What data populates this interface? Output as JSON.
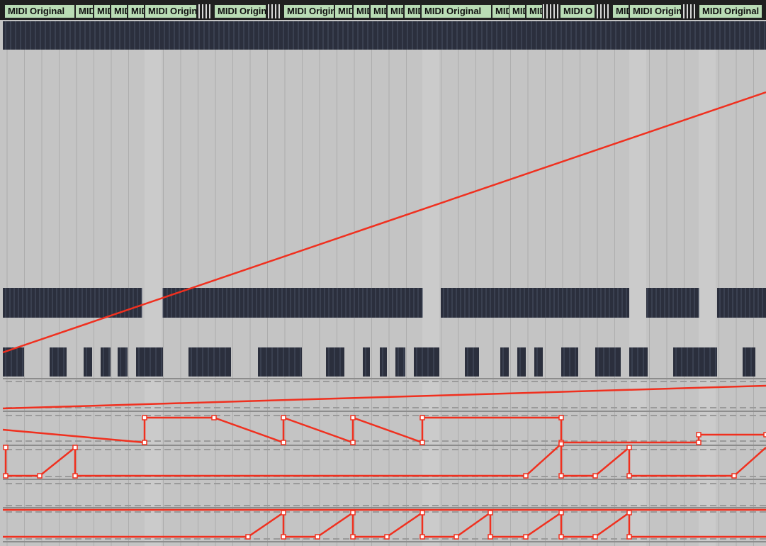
{
  "clip_label": "MIDI Original",
  "clip_label_short": "MIDI",
  "clip_label_mid": "MIDI Origin",
  "clip_label_cut": "MIDI O",
  "colors": {
    "clip_fill": "#b9dcb5",
    "track_background": "#c4c4c4",
    "grid_line": "#adadad",
    "midi_note_block": "#2b2f3d",
    "automation_line": "#f0301f",
    "lane_divider": "#8c8c8c"
  }
}
